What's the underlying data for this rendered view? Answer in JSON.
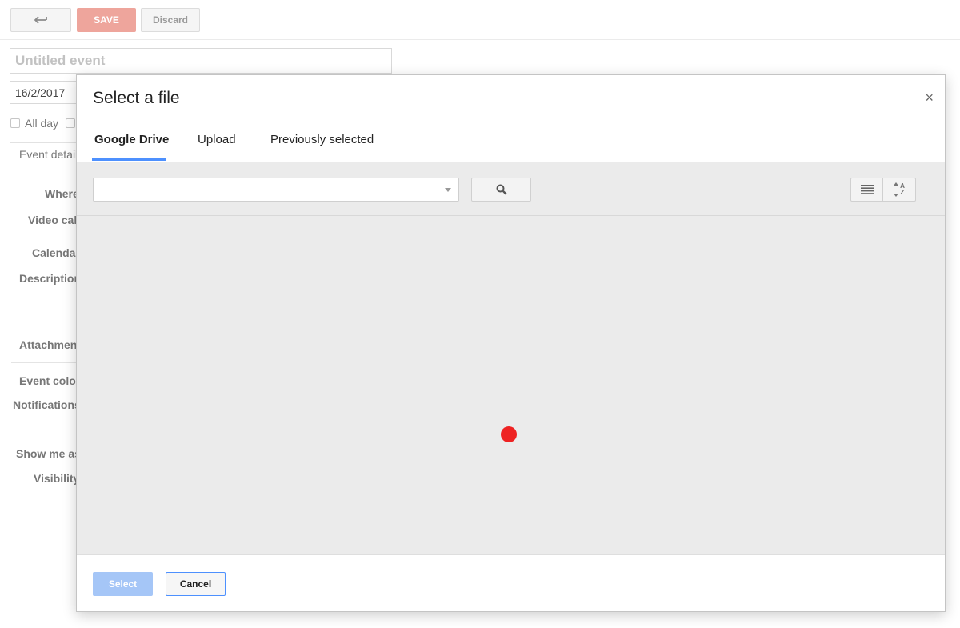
{
  "editor": {
    "save_label": "SAVE",
    "discard_label": "Discard",
    "title_placeholder": "Untitled event",
    "date_value": "16/2/2017",
    "all_day_label": "All day",
    "details_tab_label": "Event details",
    "labels": {
      "where": "Where",
      "video_call": "Video call",
      "calendar": "Calendar",
      "description": "Description",
      "attachment": "Attachment",
      "event_color": "Event color",
      "notifications": "Notifications",
      "show_me_as": "Show me as",
      "visibility": "Visibility"
    }
  },
  "dialog": {
    "title": "Select a file",
    "close_glyph": "×",
    "tabs": [
      {
        "label": "Google Drive",
        "active": true
      },
      {
        "label": "Upload",
        "active": false
      },
      {
        "label": "Previously selected",
        "active": false
      }
    ],
    "search": {
      "value": "",
      "placeholder": ""
    },
    "sort_label_top": "A",
    "sort_label_bottom": "Z",
    "select_label": "Select",
    "cancel_label": "Cancel"
  },
  "colors": {
    "accent": "#4d90fe",
    "save_button": "#eea59c",
    "select_disabled": "#a5c6f7",
    "loading_dot": "#ee2222",
    "picker_background": "#ebebeb"
  },
  "icons": [
    "back-arrow-icon",
    "close-icon",
    "search-icon",
    "list-view-icon",
    "sort-az-icon",
    "dropdown-caret-icon"
  ]
}
